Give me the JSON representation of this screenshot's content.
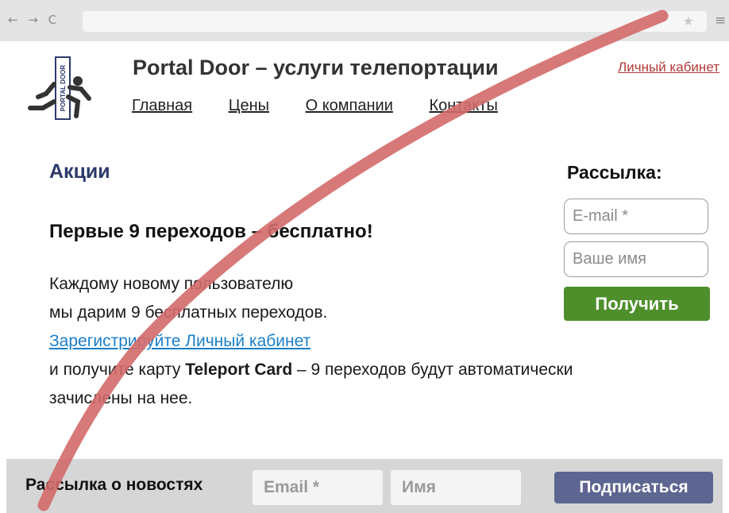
{
  "browser": {
    "nav_glyphs": "← → C",
    "star_glyph": "★",
    "menu_glyph": "≡"
  },
  "header": {
    "logo_text": "PORTAL DOOR",
    "site_title": "Portal Door – услуги телепортации",
    "login_link": "Личный кабинет",
    "nav": [
      "Главная",
      "Цены",
      "О компании",
      "Контакты"
    ]
  },
  "promo": {
    "heading": "Акции",
    "title": "Первые 9 переходов – бесплатно!",
    "line1": "Каждому новому пользователю",
    "line2": "мы дарим 9 бесплатных переходов.",
    "register_link": "Зарегистрируйте Личный кабинет",
    "line4_before": "и получите карту ",
    "card_name": "Teleport Card",
    "line4_after": " – 9 переходов будут автоматически",
    "line5": "зачислены на нее."
  },
  "newsletter_side": {
    "title": "Рассылка:",
    "email_placeholder": "E-mail *",
    "name_placeholder": "Ваше имя",
    "button_label": "Получить"
  },
  "footer": {
    "label": "Рассылка о новостях",
    "email_placeholder": "Email *",
    "name_placeholder": "Имя",
    "button_label": "Подписаться"
  },
  "colors": {
    "strike_line": "#d46a6a",
    "green_button": "#4e8f2c",
    "subscribe_button": "#5d6690",
    "heading": "#2b3a6a",
    "link": "#1a7fc8",
    "login_link": "#b23a3a"
  }
}
